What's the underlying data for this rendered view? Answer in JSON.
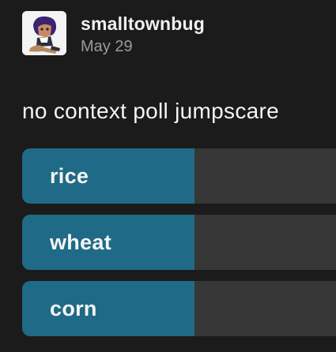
{
  "post": {
    "username": "smalltownbug",
    "date": "May 29",
    "avatar_icon": "anime-character-avatar",
    "question": "no context poll jumpscare"
  },
  "poll": {
    "options": [
      {
        "label": "rice",
        "fill_fraction": 0.55
      },
      {
        "label": "wheat",
        "fill_fraction": 0.55
      },
      {
        "label": "corn",
        "fill_fraction": 0.55
      }
    ]
  },
  "colors": {
    "background": "#1b1b1b",
    "option_fill": "#1f6a86",
    "option_track": "#363636",
    "date_text": "#9b9b9b"
  }
}
